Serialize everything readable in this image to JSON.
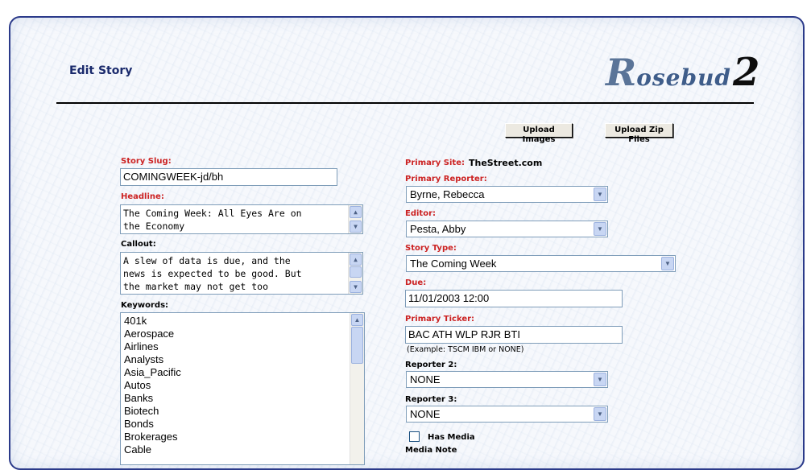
{
  "header": {
    "page_title": "Edit Story",
    "logo": {
      "r": "R",
      "rest": "osebud",
      "num": "2"
    }
  },
  "toolbar": {
    "upload_images": "Upload Images",
    "upload_zip": "Upload Zip Files"
  },
  "left": {
    "story_slug_label": "Story Slug:",
    "story_slug_value": "COMINGWEEK-jd/bh",
    "headline_label": "Headline:",
    "headline_value": "The Coming Week: All Eyes Are on\nthe Economy",
    "callout_label": "Callout:",
    "callout_value": "A slew of data is due, and the\nnews is expected to be good. But\nthe market may not get too",
    "keywords_label": "Keywords:",
    "keywords": [
      "401k",
      "Aerospace",
      "Airlines",
      "Analysts",
      "Asia_Pacific",
      "Autos",
      "Banks",
      "Biotech",
      "Bonds",
      "Brokerages",
      "Cable"
    ]
  },
  "right": {
    "primary_site_label": "Primary Site:",
    "primary_site_value": "TheStreet.com",
    "primary_reporter_label": "Primary Reporter:",
    "primary_reporter_value": "Byrne, Rebecca",
    "editor_label": "Editor:",
    "editor_value": "Pesta, Abby",
    "story_type_label": "Story Type:",
    "story_type_value": "The Coming Week",
    "due_label": "Due:",
    "due_value": "11/01/2003 12:00",
    "primary_ticker_label": "Primary Ticker:",
    "primary_ticker_value": "BAC ATH WLP RJR BTI",
    "ticker_example": "(Example: TSCM IBM or NONE)",
    "reporter2_label": "Reporter 2:",
    "reporter2_value": "NONE",
    "reporter3_label": "Reporter 3:",
    "reporter3_value": "NONE",
    "has_media_label": "Has Media",
    "has_media_checked": false,
    "media_note_label": "Media Note"
  },
  "icons": {
    "scroll_up": "scroll-up-arrow",
    "scroll_down": "scroll-down-arrow",
    "dropdown": "dropdown-arrow"
  },
  "colors": {
    "required_label": "#cc2222",
    "frame_border": "#2b3a8a",
    "title": "#1a2a6c"
  }
}
